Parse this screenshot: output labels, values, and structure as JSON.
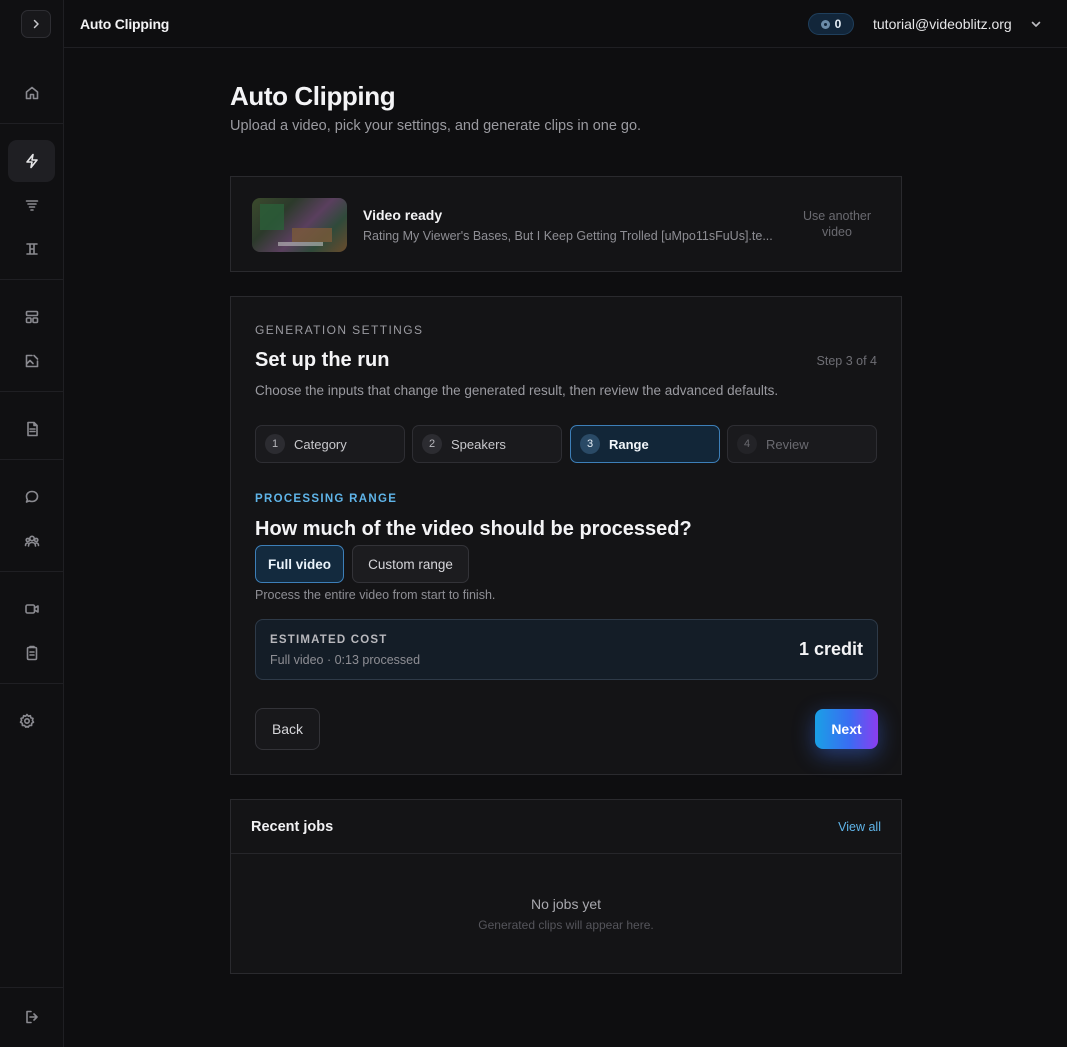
{
  "app": {
    "title": "Auto Clipping"
  },
  "topbar": {
    "credits": "0",
    "user_email": "tutorial@videoblitz.org"
  },
  "page": {
    "title": "Auto Clipping",
    "subtitle": "Upload a video, pick your settings, and generate clips in one go."
  },
  "video": {
    "status": "Video ready",
    "filename": "Rating My Viewer's Bases, But I Keep Getting Trolled [uMpo11sFuUs].te...",
    "use_another": "Use another video"
  },
  "settings": {
    "eyebrow": "GENERATION SETTINGS",
    "title": "Set up the run",
    "step_count": "Step 3 of 4",
    "subtitle": "Choose the inputs that change the generated result, then review the advanced defaults.",
    "steps": [
      {
        "num": "1",
        "label": "Category"
      },
      {
        "num": "2",
        "label": "Speakers"
      },
      {
        "num": "3",
        "label": "Range"
      },
      {
        "num": "4",
        "label": "Review"
      }
    ],
    "section_eyebrow": "PROCESSING RANGE",
    "question": "How much of the video should be processed?",
    "options": {
      "full": "Full video",
      "custom": "Custom range"
    },
    "option_desc": "Process the entire video from start to finish.",
    "cost": {
      "label": "ESTIMATED COST",
      "detail": "Full video · 0:13 processed",
      "value": "1 credit"
    },
    "back_label": "Back",
    "next_label": "Next"
  },
  "jobs": {
    "title": "Recent jobs",
    "view_all": "View all",
    "empty_title": "No jobs yet",
    "empty_sub": "Generated clips will appear here."
  },
  "sidebar": {
    "icons": [
      "home-icon",
      "zap-icon",
      "filter-icon",
      "text-cursor-icon",
      "layout-icon",
      "image-edit-icon",
      "file-text-icon",
      "message-icon",
      "users-icon",
      "video-icon",
      "clipboard-icon",
      "settings-icon",
      "logout-icon"
    ]
  },
  "colors": {
    "accent": "#5fb4e8",
    "active_border": "#3d7fb8",
    "next_gradient_start": "#1aa0e6",
    "next_gradient_end": "#8b3df0"
  }
}
